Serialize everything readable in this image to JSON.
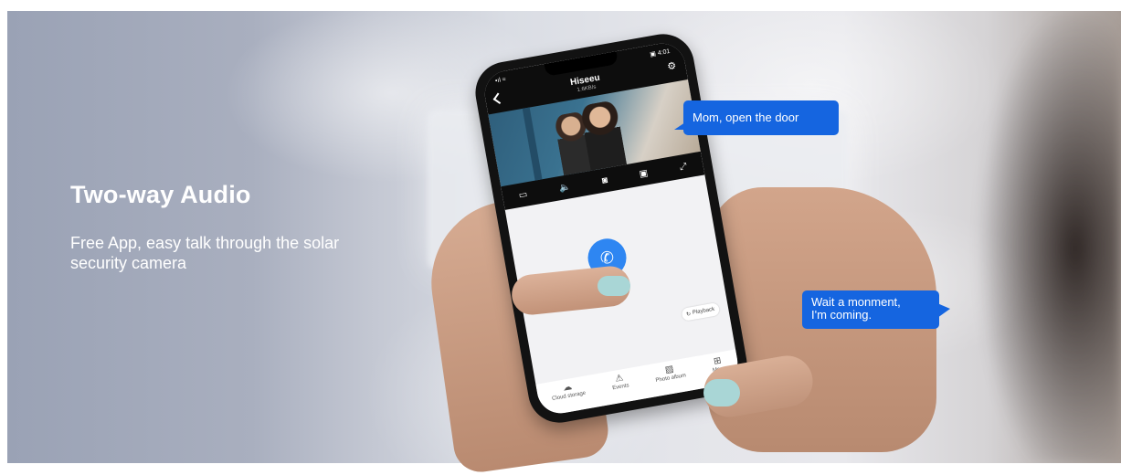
{
  "hero": {
    "title": "Two-way Audio",
    "subtitle": "Free App, easy talk through the solar security camera"
  },
  "bubbles": {
    "child": "Mom, open the door",
    "parent_line1": "Wait a monment,",
    "parent_line2": "I'm coming."
  },
  "phone": {
    "status_left": "•ıl ≈",
    "status_right": "▣ 4:01",
    "device_name": "Hiseeu",
    "device_sub": "1.6KB/s",
    "controls": [
      "sd-card-icon",
      "mute-icon",
      "snapshot-icon",
      "record-icon",
      "fullscreen-icon"
    ],
    "playback_label": "Playback",
    "nav": {
      "cloud": "Cloud storage",
      "events": "Events",
      "photo_album": "Photo album",
      "more": "More"
    }
  },
  "colors": {
    "accent": "#2e86f2",
    "bubble": "#1565e0",
    "nail": "#a9d6d6"
  }
}
